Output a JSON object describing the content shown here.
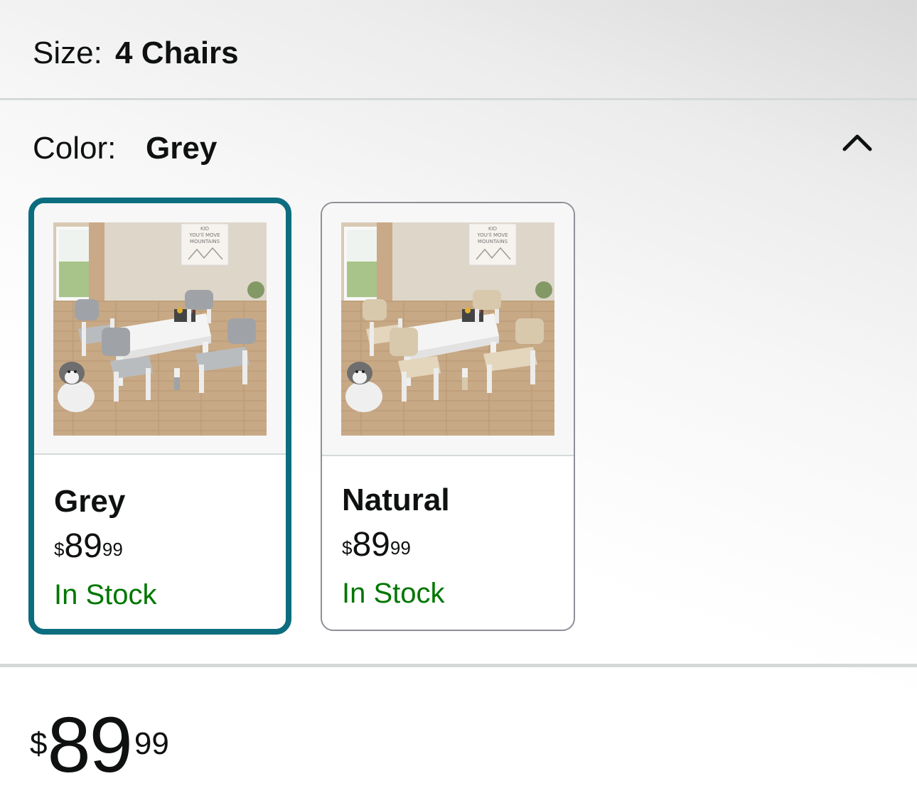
{
  "size": {
    "label": "Size:",
    "value": "4 Chairs"
  },
  "color": {
    "label": "Color:",
    "value": "Grey",
    "toggle_icon": "chevron-up-icon",
    "options": [
      {
        "name": "Grey",
        "price_symbol": "$",
        "price_whole": "89",
        "price_fraction": "99",
        "availability": "In Stock",
        "selected": true,
        "chair_color": "#9fa3a7",
        "seat_color": "#b9bcbf"
      },
      {
        "name": "Natural",
        "price_symbol": "$",
        "price_whole": "89",
        "price_fraction": "99",
        "availability": "In Stock",
        "selected": false,
        "chair_color": "#d8c9ad",
        "seat_color": "#e3d6bd"
      }
    ]
  },
  "price": {
    "symbol": "$",
    "whole": "89",
    "fraction": "99"
  },
  "poster_text": [
    "KID",
    "YOU'll MOVE",
    "MOUNTAINS"
  ],
  "colors": {
    "selected_border": "#0c6d7e",
    "in_stock": "#007600",
    "divider": "#d5d9d9",
    "text": "#0f1111"
  }
}
